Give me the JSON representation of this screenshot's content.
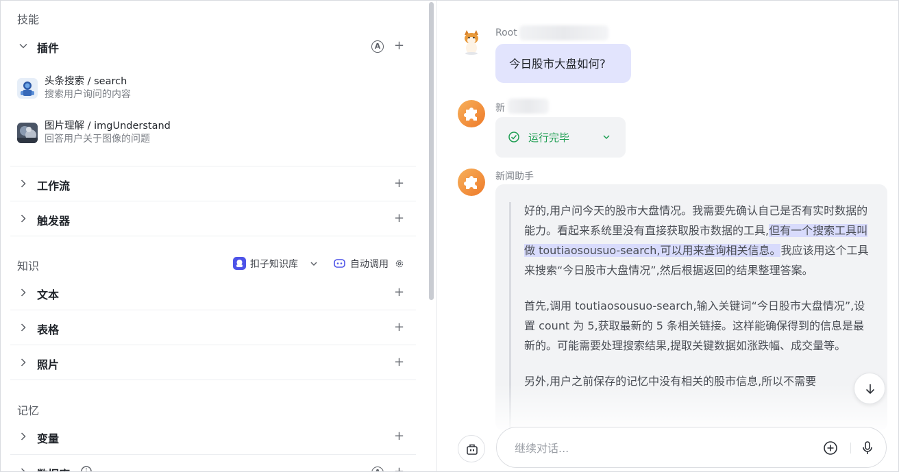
{
  "left": {
    "skills_title": "技能",
    "plugins": {
      "label": "插件",
      "auto_badge": "A",
      "add": "+",
      "items": [
        {
          "name": "头条搜索 / search",
          "desc": "搜索用户询问的内容"
        },
        {
          "name": "图片理解 / imgUnderstand",
          "desc": "回答用户关于图像的问题"
        }
      ]
    },
    "workflow": {
      "label": "工作流",
      "add": "+"
    },
    "trigger": {
      "label": "触发器",
      "add": "+"
    },
    "knowledge_title": "知识",
    "knowledge_base": "扣子知识库",
    "auto_call": "自动调用",
    "text": {
      "label": "文本",
      "add": "+"
    },
    "table": {
      "label": "表格",
      "add": "+"
    },
    "photo": {
      "label": "照片",
      "add": "+"
    },
    "memory_title": "记忆",
    "variable": {
      "label": "变量",
      "add": "+"
    },
    "database": {
      "label": "数据库",
      "add": "+"
    }
  },
  "chat": {
    "user_name": "Root",
    "user_message": "今日股市大盘如何?",
    "bot_name_partial": "新",
    "run_status": "运行完毕",
    "bot_name": "新闻助手",
    "answer": {
      "p1_a": "好的,用户问今天的股市大盘情况。我需要先确认自己是否有实时数据的能力。看起来系统里没有直接获取股市数据的工具,",
      "p1_hl": "但有一个搜索工具叫做 toutiaosousuo-search,可以用来查询相关信息。",
      "p1_b": "我应该用这个工具来搜索“今日股市大盘情况”,然后根据返回的结果整理答案。",
      "p2": "首先,调用 toutiaosousuo-search,输入关键词“今日股市大盘情况”,设置 count 为 5,获取最新的 5 条相关链接。这样能确保得到的信息是最新的。可能需要处理搜索结果,提取关键数据如涨跌幅、成交量等。",
      "p3": "另外,用户之前保存的记忆中没有相关的股市信息,所以不需要"
    },
    "input_placeholder": "继续对话...",
    "input_value": ""
  },
  "colors": {
    "accent": "#4d53e8",
    "success": "#1e9e52",
    "user_bubble": "#e2e4fd",
    "highlight": "#d8dbfc"
  }
}
